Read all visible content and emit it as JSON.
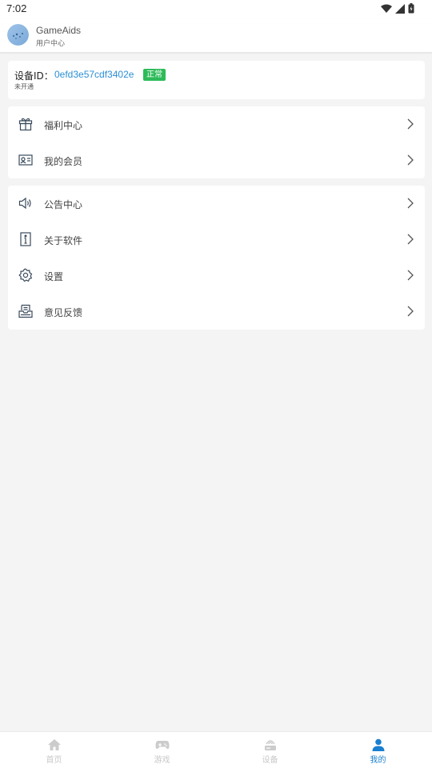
{
  "status_bar": {
    "time": "7:02",
    "icons": [
      "wifi-icon",
      "signal-icon",
      "battery-icon"
    ]
  },
  "header": {
    "app_name": "GameAids",
    "subtitle": "用户中心"
  },
  "device": {
    "label": "设备ID：",
    "id": "0efd3e57cdf3402e",
    "badge": "正常",
    "status": "未开通",
    "badge_color": "#2dbb5a",
    "id_color": "#2a8fd6"
  },
  "menu_group_1": [
    {
      "label": "福利中心",
      "icon": "gift-icon"
    },
    {
      "label": "我的会员",
      "icon": "member-card-icon"
    }
  ],
  "menu_group_2": [
    {
      "label": "公告中心",
      "icon": "speaker-icon"
    },
    {
      "label": "关于软件",
      "icon": "info-icon"
    },
    {
      "label": "设置",
      "icon": "gear-icon"
    },
    {
      "label": "意见反馈",
      "icon": "feedback-inbox-icon"
    }
  ],
  "bottom_nav": [
    {
      "label": "首页",
      "icon": "home-icon",
      "active": false
    },
    {
      "label": "游戏",
      "icon": "gamepad-icon",
      "active": false
    },
    {
      "label": "设备",
      "icon": "device-icon",
      "active": false
    },
    {
      "label": "我的",
      "icon": "user-icon",
      "active": true
    }
  ],
  "colors": {
    "accent": "#1a7fd0",
    "inactive": "#c8c8c8",
    "background": "#f4f4f4"
  }
}
